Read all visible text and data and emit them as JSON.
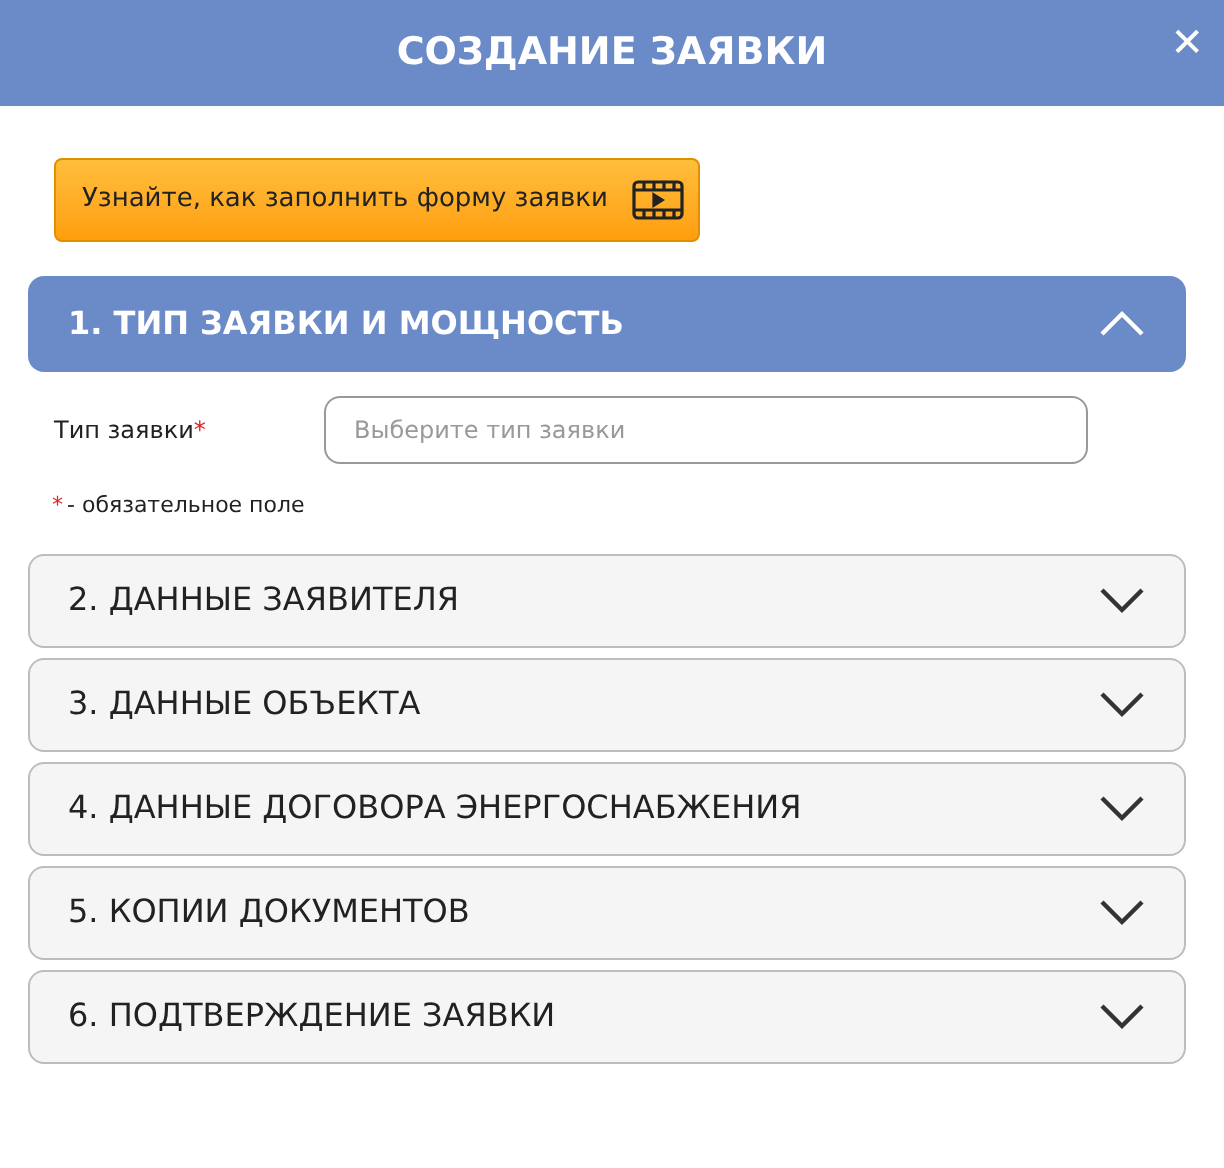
{
  "header": {
    "title": "СОЗДАНИЕ ЗАЯВКИ",
    "close": "✕"
  },
  "help_button": {
    "label": "Узнайте, как заполнить форму заявки"
  },
  "sections": [
    {
      "title": "1. ТИП ЗАЯВКИ И МОЩНОСТЬ",
      "expanded": true,
      "fields": [
        {
          "label": "Тип заявки",
          "required_mark": "*",
          "placeholder": "Выберите тип заявки"
        }
      ],
      "note": {
        "mark": "*",
        "text": "- обязательное поле"
      }
    },
    {
      "title": "2. ДАННЫЕ ЗАЯВИТЕЛЯ",
      "expanded": false
    },
    {
      "title": "3. ДАННЫЕ ОБЪЕКТА",
      "expanded": false
    },
    {
      "title": "4. ДАННЫЕ ДОГОВОРА ЭНЕРГОСНАБЖЕНИЯ",
      "expanded": false
    },
    {
      "title": "5. КОПИИ ДОКУМЕНТОВ",
      "expanded": false
    },
    {
      "title": "6. ПОДТВЕРЖДЕНИЕ ЗАЯВКИ",
      "expanded": false
    }
  ]
}
